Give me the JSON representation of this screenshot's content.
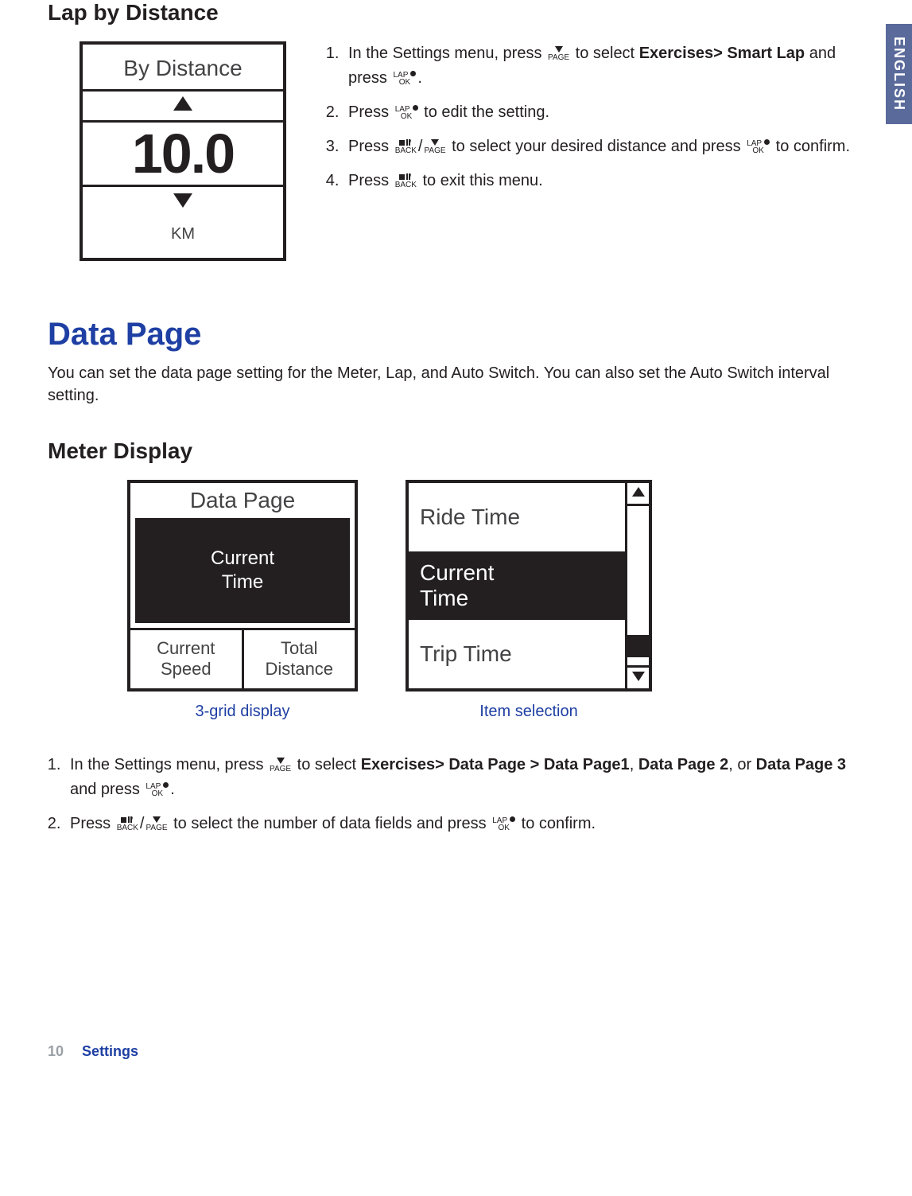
{
  "lang_tab": "ENGLISH",
  "lap_by_distance": {
    "heading": "Lap by Distance",
    "device": {
      "title": "By Distance",
      "value": "10.0",
      "unit": "KM"
    },
    "steps": {
      "s1_a": "In the Settings menu, press ",
      "s1_b": " to select ",
      "s1_bold": "Exercises> Smart Lap",
      "s1_c": " and press ",
      "s1_d": ".",
      "s2_a": "Press ",
      "s2_b": " to edit the setting.",
      "s3_a": "Press ",
      "s3_b": "/",
      "s3_c": " to select your desired distance and press ",
      "s3_d": " to confirm.",
      "s4_a": "Press ",
      "s4_b": " to exit this menu."
    }
  },
  "data_page": {
    "heading": "Data Page",
    "intro": "You can set the data page setting for the Meter, Lap, and Auto Switch. You can also set the Auto Switch interval setting.",
    "meter_heading": "Meter Display",
    "display1": {
      "title": "Data Page",
      "big_line1": "Current",
      "big_line2": "Time",
      "cell1_line1": "Current",
      "cell1_line2": "Speed",
      "cell2_line1": "Total",
      "cell2_line2": "Distance",
      "caption": "3-grid display"
    },
    "display2": {
      "item1": "Ride Time",
      "item2_line1": "Current",
      "item2_line2": "Time",
      "item3": "Trip Time",
      "caption": "Item selection"
    },
    "steps": {
      "s1_a": "In the Settings menu, press ",
      "s1_b": " to select ",
      "s1_bold1": "Exercises> Data Page > Data Page1",
      "s1_mid": ", ",
      "s1_bold2": "Data Page 2",
      "s1_mid2": ", or ",
      "s1_bold3": "Data Page 3",
      "s1_c": "  and press ",
      "s1_d": ".",
      "s2_a": "Press ",
      "s2_b": "/",
      "s2_c": " to select the number of data fields and press ",
      "s2_d": " to confirm."
    }
  },
  "buttons": {
    "page_top": "",
    "page_bot": "PAGE",
    "lapok_top": "LAP",
    "lapok_bot": "OK",
    "back_top": "",
    "back_bot": "BACK"
  },
  "footer": {
    "page_num": "10",
    "section": "Settings"
  }
}
